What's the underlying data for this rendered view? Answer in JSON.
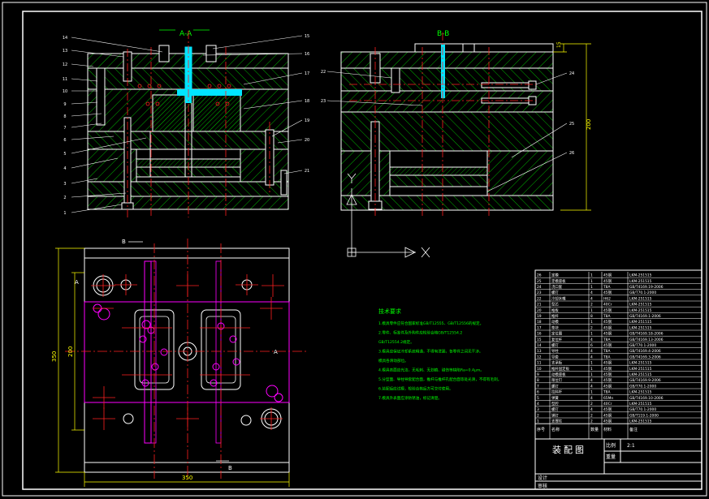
{
  "drawing": {
    "section_a_label": "A-A",
    "section_b_label": "B-B",
    "plan_marker_b": "B",
    "plan_marker_a": "A",
    "plan_marker_a_left": "A",
    "plan_dim_width_outer": "350",
    "plan_dim_width": "350",
    "plan_dim_height_outer": "350",
    "plan_dim_height": "200",
    "side_dim_height": "200",
    "side_dim_top": "15",
    "axis_x": "X",
    "axis_y": "Y"
  },
  "left_view_balloons": [
    "14",
    "13",
    "12",
    "11",
    "10",
    "9",
    "8",
    "7",
    "6",
    "5",
    "4",
    "3",
    "2",
    "1"
  ],
  "right_view_balloons": [
    "15",
    "16",
    "17",
    "18",
    "19",
    "20",
    "21"
  ],
  "bb_view_balloons": [
    "22",
    "23",
    "24",
    "25",
    "26"
  ],
  "tech": {
    "title": "技术要求",
    "lines": [
      "1.模具零件应符合国家标准GB/T12555、GB/T12556的规定。",
      "2.零件、标准件及外购件应检验合格GB/T12554.2",
      "GB/T12554.2规定。",
      "3.模具应保证冷却系统畅通，不得有泄漏，各零件之间无干涉。",
      "模具各滑动部位。",
      "4.模具表面应光洁，无毛刺、无划痕、碰伤等缺陷Ra=0.4μm。",
      "5.分型面、导柱导套配合面，推杆与推杆孔配合面等处光滑，不得有毛刺。",
      "6.装配后应试模，检验合格后方可交付使用。",
      "7.模具外表面应涂防锈油，标记清楚。"
    ]
  },
  "title_block": {
    "heading": "装配图",
    "scale_label": "比例",
    "scale_value": "2:1",
    "sheet_label": "重量",
    "header": [
      "序号",
      "名称",
      "数量",
      "材料",
      "备注"
    ],
    "designer": "设计",
    "checker": "审核"
  },
  "bom": [
    {
      "no": "26",
      "name": "定模",
      "qty": "1",
      "mat": "45钢",
      "std": "LKM-251515"
    },
    {
      "no": "25",
      "name": "定模座板",
      "qty": "1",
      "mat": "45钢",
      "std": "LKM-251515"
    },
    {
      "no": "24",
      "name": "浇口套",
      "qty": "1",
      "mat": "T8A",
      "std": "GB/T4169.19-2006"
    },
    {
      "no": "23",
      "name": "螺钉",
      "qty": "4",
      "mat": "45钢",
      "std": "GB/T70.1-2000"
    },
    {
      "no": "22",
      "name": "冷却水嘴",
      "qty": "4",
      "mat": "H62",
      "std": "LKM-251515"
    },
    {
      "no": "21",
      "name": "型芯",
      "qty": "2",
      "mat": "40Cr",
      "std": "LKM-251515"
    },
    {
      "no": "20",
      "name": "推板",
      "qty": "1",
      "mat": "45钢",
      "std": "LKM-251515"
    },
    {
      "no": "19",
      "name": "推杆",
      "qty": "8",
      "mat": "T8A",
      "std": "GB/T4169.1-2006"
    },
    {
      "no": "18",
      "name": "动模",
      "qty": "1",
      "mat": "45钢",
      "std": "LKM-251515"
    },
    {
      "no": "17",
      "name": "垫块",
      "qty": "2",
      "mat": "45钢",
      "std": "LKM-251515"
    },
    {
      "no": "16",
      "name": "定位圈",
      "qty": "1",
      "mat": "45钢",
      "std": "GB/T4169.18-2006"
    },
    {
      "no": "15",
      "name": "复位杆",
      "qty": "4",
      "mat": "T8A",
      "std": "GB/T4169.13-2006"
    },
    {
      "no": "14",
      "name": "螺钉",
      "qty": "6",
      "mat": "45钢",
      "std": "GB/T70.1-2000"
    },
    {
      "no": "13",
      "name": "导柱",
      "qty": "4",
      "mat": "T8A",
      "std": "GB/T4169.4-2006"
    },
    {
      "no": "12",
      "name": "导套",
      "qty": "4",
      "mat": "T8A",
      "std": "GB/T4169.3-2006"
    },
    {
      "no": "11",
      "name": "支承板",
      "qty": "1",
      "mat": "45钢",
      "std": "LKM-251515"
    },
    {
      "no": "10",
      "name": "推杆固定板",
      "qty": "1",
      "mat": "45钢",
      "std": "LKM-251515"
    },
    {
      "no": "9",
      "name": "动模座板",
      "qty": "1",
      "mat": "45钢",
      "std": "LKM-251515"
    },
    {
      "no": "8",
      "name": "限位钉",
      "qty": "4",
      "mat": "45钢",
      "std": "GB/T4169.9-2006"
    },
    {
      "no": "7",
      "name": "螺钉",
      "qty": "4",
      "mat": "45钢",
      "std": "GB/T70.1-2000"
    },
    {
      "no": "6",
      "name": "拉料杆",
      "qty": "1",
      "mat": "T8A",
      "std": "LKM-251515"
    },
    {
      "no": "5",
      "name": "弹簧",
      "qty": "4",
      "mat": "65Mn",
      "std": "GB/T4169.10-2006"
    },
    {
      "no": "4",
      "name": "型腔",
      "qty": "2",
      "mat": "40Cr",
      "std": "LKM-251515"
    },
    {
      "no": "3",
      "name": "螺钉",
      "qty": "4",
      "mat": "45钢",
      "std": "GB/T70.1-2000"
    },
    {
      "no": "2",
      "name": "销钉",
      "qty": "2",
      "mat": "45钢",
      "std": "GB/T119.1-2000"
    },
    {
      "no": "1",
      "name": "支撑柱",
      "qty": "2",
      "mat": "45钢",
      "std": "LKM-251515"
    }
  ],
  "colors": {
    "background": "#000000",
    "frame": "#ffffff",
    "outline": "#ffffff",
    "hatch": "#00b000",
    "centerline": "#ff2020",
    "runner": "#00e5ff",
    "plan_feature": "#ff00ff",
    "dimension": "#ffff00",
    "text_note": "#00ff00"
  }
}
